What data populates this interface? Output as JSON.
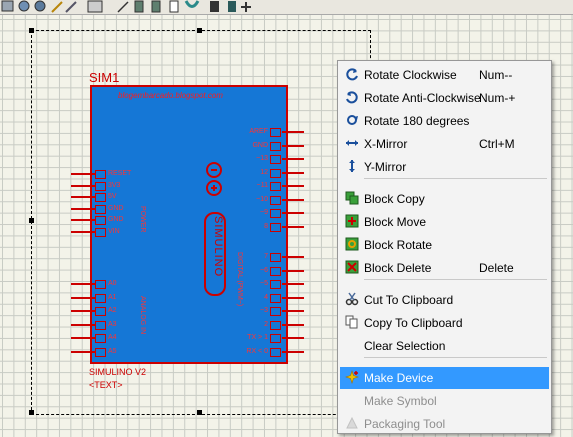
{
  "schematic": {
    "part_ref": "SIM1",
    "url": "blogembarcado.blogspot.com",
    "part_name": "SIMULINO V2",
    "text_placeholder": "<TEXT>",
    "logo_text": "SIMULINO",
    "left_pins_top": [
      "RESET",
      "3V3",
      "5V",
      "GND",
      "GND",
      "VIN"
    ],
    "left_pins_bottom": [
      "A0",
      "A1",
      "A2",
      "A3",
      "A4",
      "A5"
    ],
    "right_pins_top": [
      "AREF",
      "GND",
      "~13",
      "12",
      "~11",
      "~10",
      "~9",
      "8"
    ],
    "right_pins_bottom": [
      "7",
      "~6",
      "~5",
      "4",
      "~3",
      "2",
      "TX > 1",
      "RX < 0"
    ],
    "power_label": "POWER",
    "analog_label": "ANALOG IN",
    "digital_label": "DIGITAL (PWM~)"
  },
  "context_menu": {
    "items": [
      {
        "label": "Rotate Clockwise",
        "shortcut": "Num--",
        "icon": "rotate-clockwise-icon",
        "disabled": false,
        "highlight": false
      },
      {
        "label": "Rotate Anti-Clockwise",
        "shortcut": "Num-+",
        "icon": "rotate-anticlockwise-icon",
        "disabled": false,
        "highlight": false
      },
      {
        "label": "Rotate 180 degrees",
        "shortcut": "",
        "icon": "rotate-180-icon",
        "disabled": false,
        "highlight": false
      },
      {
        "label": "X-Mirror",
        "shortcut": "Ctrl+M",
        "icon": "x-mirror-icon",
        "disabled": false,
        "highlight": false
      },
      {
        "label": "Y-Mirror",
        "shortcut": "",
        "icon": "y-mirror-icon",
        "disabled": false,
        "highlight": false
      },
      {
        "label": "Block Copy",
        "shortcut": "",
        "icon": "block-copy-icon",
        "disabled": false,
        "highlight": false
      },
      {
        "label": "Block Move",
        "shortcut": "",
        "icon": "block-move-icon",
        "disabled": false,
        "highlight": false
      },
      {
        "label": "Block Rotate",
        "shortcut": "",
        "icon": "block-rotate-icon",
        "disabled": false,
        "highlight": false
      },
      {
        "label": "Block Delete",
        "shortcut": "Delete",
        "icon": "block-delete-icon",
        "disabled": false,
        "highlight": false
      },
      {
        "label": "Cut To Clipboard",
        "shortcut": "",
        "icon": "scissors-icon",
        "disabled": false,
        "highlight": false
      },
      {
        "label": "Copy To Clipboard",
        "shortcut": "",
        "icon": "copy-icon",
        "disabled": false,
        "highlight": false
      },
      {
        "label": "Clear Selection",
        "shortcut": "",
        "icon": "",
        "disabled": false,
        "highlight": false
      },
      {
        "label": "Make Device",
        "shortcut": "",
        "icon": "make-device-icon",
        "disabled": false,
        "highlight": true
      },
      {
        "label": "Make Symbol",
        "shortcut": "",
        "icon": "",
        "disabled": true,
        "highlight": false
      },
      {
        "label": "Packaging Tool",
        "shortcut": "",
        "icon": "packaging-tool-icon",
        "disabled": true,
        "highlight": false
      }
    ]
  },
  "colors": {
    "board_fill": "#1577d6",
    "schematic_red": "#cc0000",
    "menu_highlight": "#3399ff"
  }
}
